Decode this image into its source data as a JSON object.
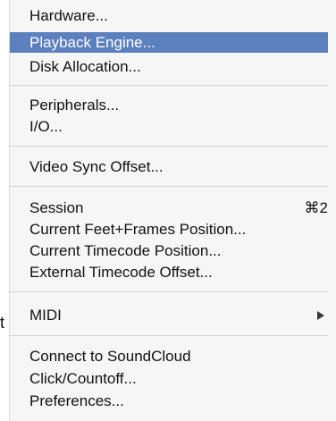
{
  "stray_char": "t",
  "menu": {
    "groups": [
      {
        "items": [
          {
            "label": "Hardware..."
          },
          {
            "label": "Playback Engine...",
            "selected": true
          },
          {
            "label": "Disk Allocation..."
          }
        ]
      },
      {
        "items": [
          {
            "label": "Peripherals..."
          },
          {
            "label": "I/O..."
          }
        ]
      },
      {
        "items": [
          {
            "label": "Video Sync Offset..."
          }
        ]
      },
      {
        "items": [
          {
            "label": "Session",
            "shortcut": "⌘2"
          },
          {
            "label": "Current Feet+Frames Position..."
          },
          {
            "label": "Current Timecode Position..."
          },
          {
            "label": "External Timecode Offset..."
          }
        ]
      },
      {
        "items": [
          {
            "label": "MIDI",
            "submenu_icon": "chevron-right-icon"
          }
        ]
      },
      {
        "items": [
          {
            "label": "Connect to SoundCloud"
          },
          {
            "label": "Click/Countoff..."
          },
          {
            "label": "Preferences..."
          }
        ]
      }
    ]
  },
  "colors": {
    "selection": "#5c80bd",
    "menu_background": "#f6f6f6",
    "separator": "#d2d2d2",
    "text": "#111111"
  }
}
